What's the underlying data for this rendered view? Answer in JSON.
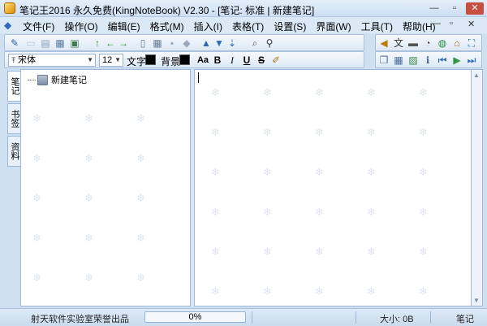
{
  "window": {
    "title": "笔记王2016 永久免费(KingNoteBook) V2.30 - [笔记: 标准 | 新建笔记]",
    "minimize": "—",
    "restore": "▫",
    "close": "✕"
  },
  "menu": {
    "items": [
      "文件(F)",
      "操作(O)",
      "编辑(E)",
      "格式(M)",
      "插入(I)",
      "表格(T)",
      "设置(S)",
      "界面(W)",
      "工具(T)",
      "帮助(H)"
    ],
    "right_controls": [
      "—",
      "▫",
      "✕"
    ]
  },
  "format_toolbar": {
    "font_name": "宋体",
    "font_size": "12",
    "text_color_label": "文字",
    "bg_color_label": "背景",
    "text_color": "#000000",
    "bg_color": "#000000",
    "buttons": [
      "Aa",
      "B",
      "I",
      "U",
      "S"
    ]
  },
  "left_tabs": [
    "笔记",
    "书签",
    "资料"
  ],
  "tree": {
    "items": [
      {
        "label": "新建笔记"
      }
    ]
  },
  "status": {
    "brand": "射天软件实验室荣誉出品",
    "progress_percent": 0,
    "progress_label": "0%",
    "size": "大小: 0B",
    "mode": "笔记"
  },
  "colors": {
    "accent": "#2a6ab8",
    "close_button": "#c84f3f"
  },
  "icons": {
    "toolbar1": [
      "pen-icon",
      "new-icon",
      "open-icon",
      "save-icon",
      "export-icon",
      "up-arrow-icon",
      "move-left-icon",
      "move-right-icon",
      "page-icon",
      "table-icon",
      "disk-icon",
      "tag-icon",
      "arrow-up-blue-icon",
      "arrow-down-blue-icon",
      "sort-icon",
      "preview-icon",
      "find-icon"
    ],
    "toolbar_right": [
      "speaker-icon",
      "translate-icon",
      "keyboard-icon",
      "clock-icon",
      "globe-icon",
      "home-icon",
      "fullscreen-icon"
    ],
    "toolbar2_right": [
      "copy-icon",
      "grid-icon",
      "image-icon",
      "info-icon",
      "first-icon",
      "play-icon",
      "last-icon"
    ]
  }
}
